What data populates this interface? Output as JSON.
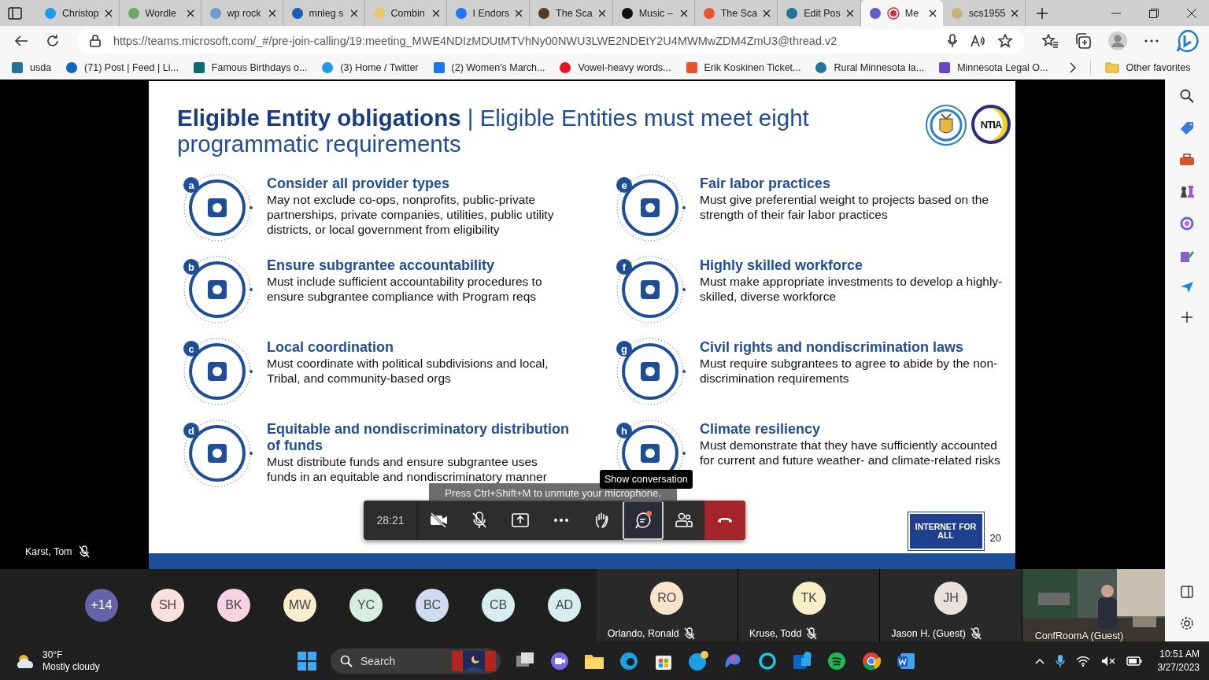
{
  "browser": {
    "tabs": [
      {
        "title": "Christop",
        "selected": false,
        "recording": false
      },
      {
        "title": "Wordle",
        "selected": false,
        "recording": false
      },
      {
        "title": "wp rock",
        "selected": false,
        "recording": false
      },
      {
        "title": "mnleg s",
        "selected": false,
        "recording": false
      },
      {
        "title": "Combin",
        "selected": false,
        "recording": false
      },
      {
        "title": "I Endors",
        "selected": false,
        "recording": false
      },
      {
        "title": "The Sca",
        "selected": false,
        "recording": false
      },
      {
        "title": "Music –",
        "selected": false,
        "recording": false
      },
      {
        "title": "The Sca",
        "selected": false,
        "recording": false
      },
      {
        "title": "Edit Pos",
        "selected": false,
        "recording": false
      },
      {
        "title": "Me",
        "selected": true,
        "recording": true
      },
      {
        "title": "scs1955",
        "selected": false,
        "recording": false
      }
    ],
    "address": "https://teams.microsoft.com/_#/pre-join-calling/19:meeting_MWE4NDIzMDUtMTVhNy00NWU3LWE2NDEtY2U4MWMwZDM4ZmU3@thread.v2",
    "bookmarks": [
      "usda",
      "(71) Post | Feed | Li...",
      "Famous Birthdays o...",
      "(3) Home / Twitter",
      "(2) Women's March...",
      "Vowel-heavy words...",
      "Erik Koskinen Ticket...",
      "Rural Minnesota la...",
      "Minnesota Legal O..."
    ],
    "other_favorites": "Other favorites"
  },
  "meeting": {
    "slide": {
      "title": "**Eligible Entity obligations** | Eligible Entities must meet eight programmatic requirements",
      "items": [
        {
          "letter": "a",
          "title": "Consider all provider types",
          "text": "May not exclude co-ops, nonprofits, public-private partnerships, private companies, utilities, public utility districts, or local government from eligibility"
        },
        {
          "letter": "b",
          "title": "Ensure subgrantee accountability",
          "text": "Must include sufficient accountability procedures to ensure subgrantee compliance with Program reqs"
        },
        {
          "letter": "c",
          "title": "Local coordination",
          "text": "Must coordinate with political subdivisions and local, Tribal, and community-based orgs"
        },
        {
          "letter": "d",
          "title": "Equitable and nondiscriminatory distribution of funds",
          "text": "Must distribute funds and ensure subgrantee uses funds in an equitable and nondiscriminatory manner"
        },
        {
          "letter": "e",
          "title": "Fair labor practices",
          "text": "Must give preferential weight to projects based on the strength of their fair labor practices"
        },
        {
          "letter": "f",
          "title": "Highly skilled workforce",
          "text": "Must make appropriate investments to develop a highly-skilled, diverse workforce"
        },
        {
          "letter": "g",
          "title": "Civil rights and nondiscrimination laws",
          "text": "Must require subgrantees to agree to abide by the non-discrimination requirements"
        },
        {
          "letter": "h",
          "title": "Climate resiliency",
          "text": "Must demonstrate that they have sufficiently accounted for current and future weather- and climate-related risks"
        }
      ],
      "logo_text": "NTIA",
      "badge": "INTERNET FOR ALL",
      "page": "20"
    },
    "presenter": {
      "name": "Karst, Tom",
      "muted": true
    },
    "call_bar": {
      "time": "28:21",
      "tooltip": "Show conversation",
      "hint": "Press Ctrl+Shift+M to unmute your microphone.",
      "buttons": [
        {
          "kind": "camera",
          "selected": false,
          "unread": false
        },
        {
          "kind": "mic",
          "selected": false,
          "unread": false
        },
        {
          "kind": "share",
          "selected": false,
          "unread": false
        },
        {
          "kind": "more",
          "selected": false,
          "unread": false
        },
        {
          "kind": "hand",
          "selected": false,
          "unread": false
        },
        {
          "kind": "chat",
          "selected": true,
          "unread": true
        },
        {
          "kind": "people",
          "selected": false,
          "unread": false
        },
        {
          "kind": "leave",
          "selected": false,
          "unread": false
        }
      ]
    },
    "participants": [
      {
        "initials": "+14",
        "color": "#6264a7"
      },
      {
        "initials": "SH",
        "color": "#fbe0dc"
      },
      {
        "initials": "BK",
        "color": "#f7d3e2"
      },
      {
        "initials": "MW",
        "color": "#fbeccf"
      },
      {
        "initials": "YC",
        "color": "#d6efe0"
      },
      {
        "initials": "BC",
        "color": "#d0dbf2"
      },
      {
        "initials": "CB",
        "color": "#d6eef0"
      },
      {
        "initials": "AD",
        "color": "#d6eeee"
      }
    ],
    "tiles": [
      {
        "initials": "RO",
        "name": "Orlando, Ronald",
        "color": "#fce3cc",
        "muted": true
      },
      {
        "initials": "TK",
        "name": "Kruse, Todd",
        "color": "#fbf0c5",
        "muted": true
      },
      {
        "initials": "JH",
        "name": "Jason H. (Guest)",
        "color": "#ebe0dc",
        "muted": true
      }
    ],
    "video_tile": {
      "name": "ConfRoomA (Guest)"
    }
  },
  "taskbar": {
    "temperature": "30°F",
    "weather": "Mostly cloudy",
    "search": "Search",
    "time": "10:51 AM",
    "date": "3/27/2023"
  }
}
